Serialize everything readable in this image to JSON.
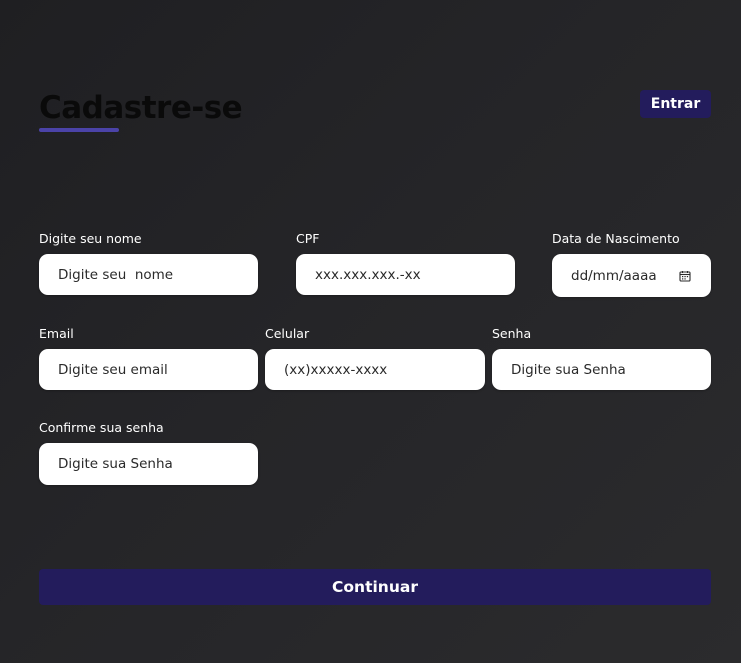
{
  "header": {
    "title": "Cadastre-se",
    "login_label": "Entrar"
  },
  "form": {
    "nome": {
      "label": "Digite seu nome",
      "placeholder": "Digite seu  nome"
    },
    "cpf": {
      "label": "CPF",
      "placeholder": "xxx.xxx.xxx.-xx"
    },
    "nascimento": {
      "label": "Data de Nascimento",
      "placeholder": "dd/mm/aaaa",
      "icon": "calendar-icon"
    },
    "email": {
      "label": "Email",
      "placeholder": "Digite seu email"
    },
    "celular": {
      "label": "Celular",
      "placeholder": "(xx)xxxxx-xxxx"
    },
    "senha": {
      "label": "Senha",
      "placeholder": "Digite sua Senha"
    },
    "confirmar_senha": {
      "label": "Confirme sua senha",
      "placeholder": "Digite sua Senha"
    }
  },
  "footer": {
    "continue_label": "Continuar"
  },
  "colors": {
    "accent": "#231c5c",
    "underline": "#4b43a8",
    "background": "#252528",
    "input_background": "#ffffff"
  }
}
